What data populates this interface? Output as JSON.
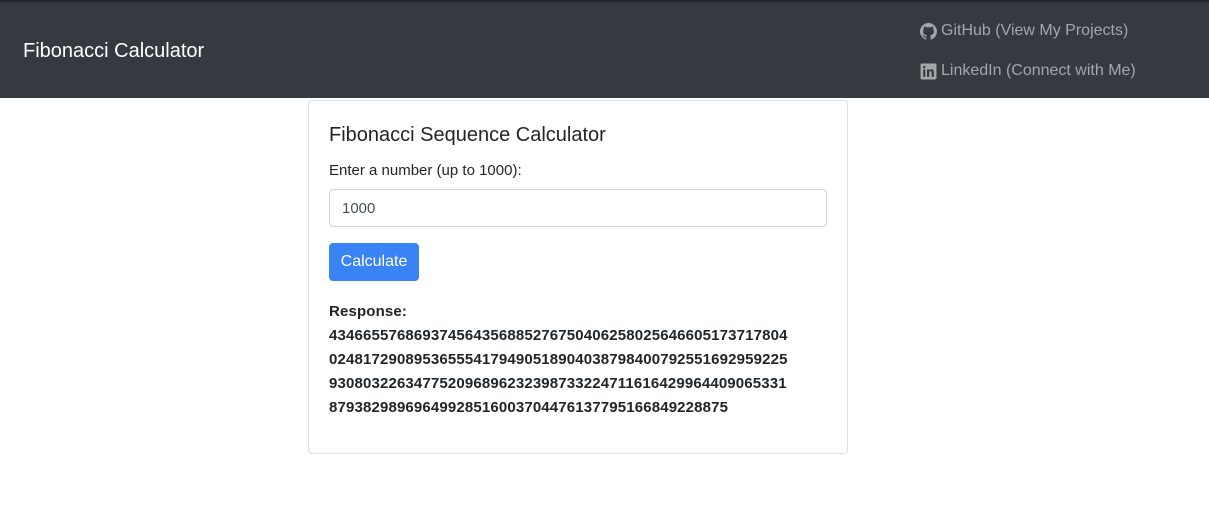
{
  "navbar": {
    "brand": "Fibonacci Calculator",
    "links": [
      {
        "label": "GitHub (View My Projects)",
        "icon": "github-icon"
      },
      {
        "label": "LinkedIn (Connect with Me)",
        "icon": "linkedin-icon"
      }
    ]
  },
  "card": {
    "title": "Fibonacci Sequence Calculator",
    "input_label": "Enter a number (up to 1000):",
    "input_value": "1000",
    "button_label": "Calculate",
    "response_label": "Response:",
    "response_lines": [
      "4346655768693745643568852767504062580256466051737178",
      "04",
      "0248172908953655541794905189040387984007925516929592",
      "25",
      "9308032263477520968962323987332247116164299644090653",
      "31",
      "8793829896964992851600370447613779516684922887",
      "5"
    ]
  },
  "colors": {
    "navbar_bg": "#343a40",
    "primary": "#3a83f5",
    "text": "#212529",
    "nav_link": "rgba(255,255,255,0.55)"
  }
}
